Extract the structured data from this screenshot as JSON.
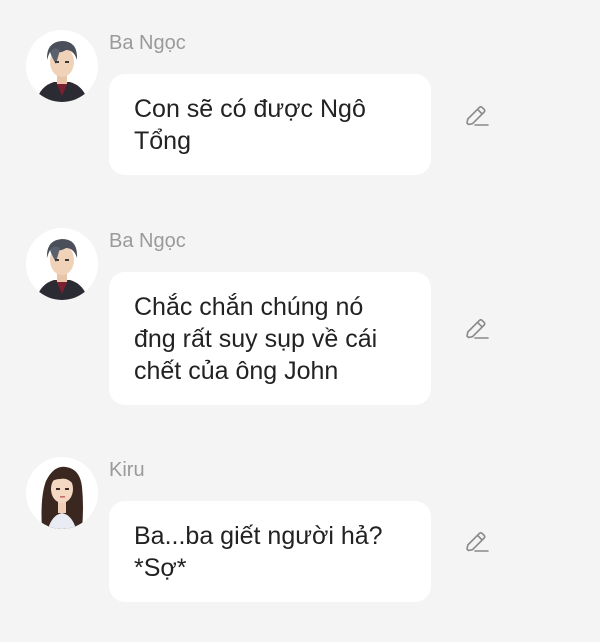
{
  "messages": [
    {
      "sender": "Ba Ngọc",
      "avatar_icon": "man-portrait-icon",
      "text": "Con sẽ có được Ngô Tổng"
    },
    {
      "sender": "Ba Ngọc",
      "avatar_icon": "man-portrait-icon",
      "text": "Chắc chắn chúng nó đng rất suy sụp về cái chết của ông John"
    },
    {
      "sender": "Kiru",
      "avatar_icon": "woman-portrait-icon",
      "text": "Ba...ba giết người hả? *Sợ*"
    }
  ],
  "colors": {
    "background": "#f4f4f4",
    "bubble": "#ffffff",
    "sender_name": "#9a9a9a",
    "message_text": "#222222",
    "edit_icon": "#8a8a8a"
  },
  "edit_icon": "pencil-edit-icon"
}
